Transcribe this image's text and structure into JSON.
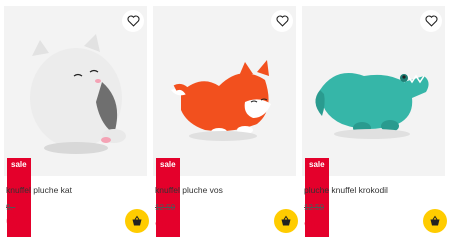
{
  "products": [
    {
      "name": "knuffel pluche kat",
      "old_price": "9.-",
      "price": "6.-",
      "badge": "sale",
      "image": "cat-plush-image",
      "colors": {
        "main": "#e9e9e9",
        "accent": "#6f6f6f"
      }
    },
    {
      "name": "knuffel pluche vos",
      "old_price": "12.50",
      "price": "8.-",
      "badge": "sale",
      "image": "fox-plush-image",
      "colors": {
        "main": "#f2501e",
        "accent": "#ffffff"
      }
    },
    {
      "name": "pluche knuffel krokodil",
      "old_price": "12.50",
      "price": "8.-",
      "badge": "sale",
      "image": "crocodile-plush-image",
      "colors": {
        "main": "#36b6a8",
        "accent": "#1f7f75"
      }
    }
  ],
  "colors": {
    "sale": "#e4002b",
    "cart": "#ffcc00",
    "image_bg": "#f3f3f3",
    "price": "#e4002b"
  },
  "icons": {
    "favorite": "heart-icon",
    "cart": "basket-icon"
  }
}
